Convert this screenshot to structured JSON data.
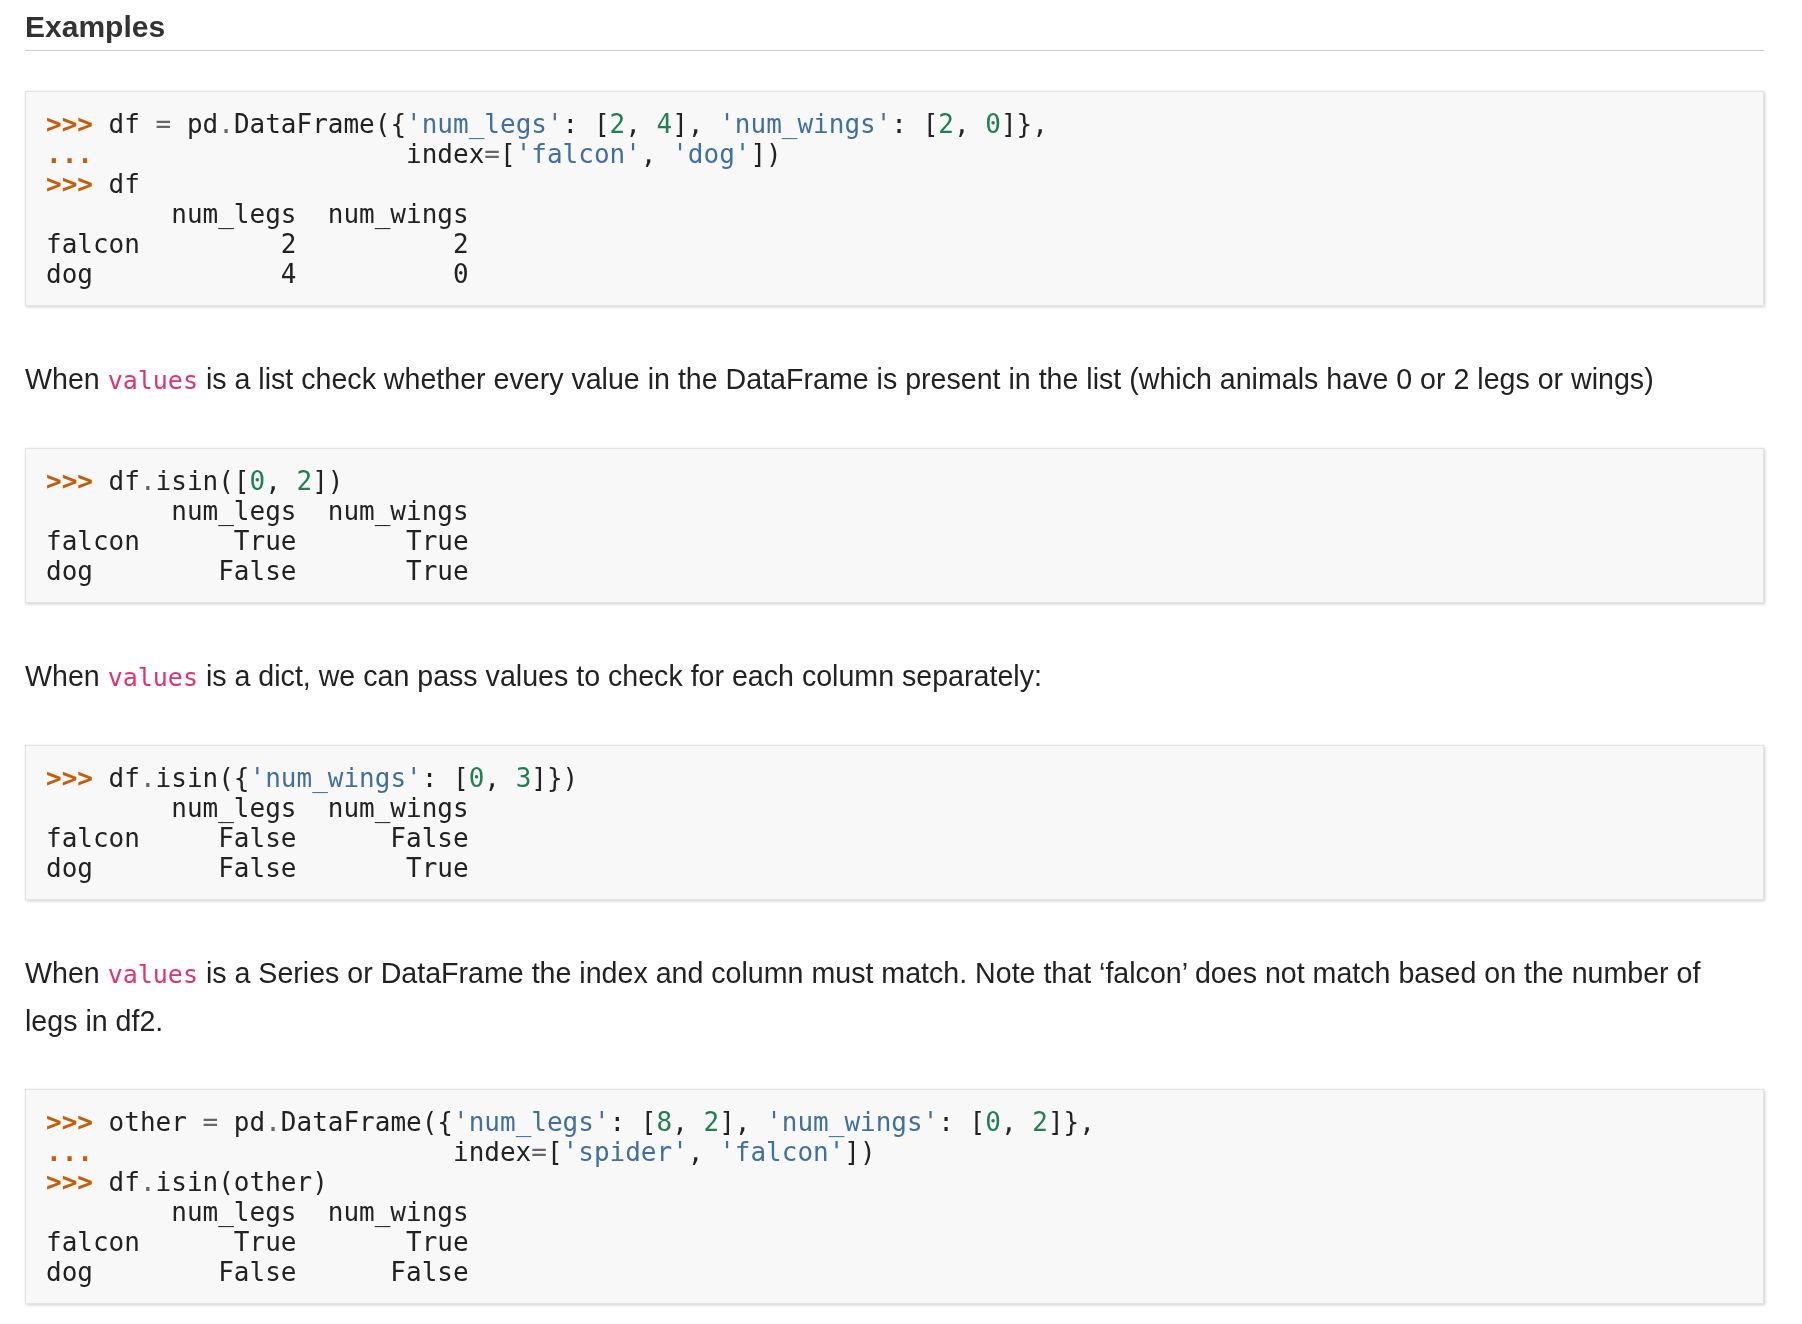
{
  "heading": "Examples",
  "blocks": [
    {
      "kind": "code",
      "lines": [
        [
          {
            "kind": "prompt",
            "text": ">>>"
          },
          {
            "kind": "plain",
            "text": " df "
          },
          {
            "kind": "op",
            "text": "="
          },
          {
            "kind": "plain",
            "text": " pd"
          },
          {
            "kind": "op",
            "text": "."
          },
          {
            "kind": "plain",
            "text": "DataFrame({"
          },
          {
            "kind": "string",
            "text": "'num_legs'"
          },
          {
            "kind": "plain",
            "text": ": ["
          },
          {
            "kind": "number",
            "text": "2"
          },
          {
            "kind": "plain",
            "text": ", "
          },
          {
            "kind": "number",
            "text": "4"
          },
          {
            "kind": "plain",
            "text": "], "
          },
          {
            "kind": "string",
            "text": "'num_wings'"
          },
          {
            "kind": "plain",
            "text": ": ["
          },
          {
            "kind": "number",
            "text": "2"
          },
          {
            "kind": "plain",
            "text": ", "
          },
          {
            "kind": "number",
            "text": "0"
          },
          {
            "kind": "plain",
            "text": "]},"
          }
        ],
        [
          {
            "kind": "prompt",
            "text": "..."
          },
          {
            "kind": "plain",
            "text": "                    index"
          },
          {
            "kind": "op",
            "text": "="
          },
          {
            "kind": "plain",
            "text": "["
          },
          {
            "kind": "string",
            "text": "'falcon'"
          },
          {
            "kind": "plain",
            "text": ", "
          },
          {
            "kind": "string",
            "text": "'dog'"
          },
          {
            "kind": "plain",
            "text": "])"
          }
        ],
        [
          {
            "kind": "prompt",
            "text": ">>>"
          },
          {
            "kind": "plain",
            "text": " df"
          }
        ],
        [
          {
            "kind": "plain",
            "text": "        num_legs  num_wings"
          }
        ],
        [
          {
            "kind": "plain",
            "text": "falcon         2          2"
          }
        ],
        [
          {
            "kind": "plain",
            "text": "dog            4          0"
          }
        ]
      ]
    },
    {
      "kind": "paragraph",
      "parts": [
        {
          "kind": "text",
          "text": "When "
        },
        {
          "kind": "code",
          "text": "values"
        },
        {
          "kind": "text",
          "text": " is a list check whether every value in the DataFrame is present in the list (which animals have 0 or 2 legs or wings)"
        }
      ]
    },
    {
      "kind": "code",
      "lines": [
        [
          {
            "kind": "prompt",
            "text": ">>>"
          },
          {
            "kind": "plain",
            "text": " df"
          },
          {
            "kind": "op",
            "text": "."
          },
          {
            "kind": "plain",
            "text": "isin(["
          },
          {
            "kind": "number",
            "text": "0"
          },
          {
            "kind": "plain",
            "text": ", "
          },
          {
            "kind": "number",
            "text": "2"
          },
          {
            "kind": "plain",
            "text": "])"
          }
        ],
        [
          {
            "kind": "plain",
            "text": "        num_legs  num_wings"
          }
        ],
        [
          {
            "kind": "plain",
            "text": "falcon      True       True"
          }
        ],
        [
          {
            "kind": "plain",
            "text": "dog        False       True"
          }
        ]
      ]
    },
    {
      "kind": "paragraph",
      "parts": [
        {
          "kind": "text",
          "text": "When "
        },
        {
          "kind": "code",
          "text": "values"
        },
        {
          "kind": "text",
          "text": " is a dict, we can pass values to check for each column separately:"
        }
      ]
    },
    {
      "kind": "code",
      "lines": [
        [
          {
            "kind": "prompt",
            "text": ">>>"
          },
          {
            "kind": "plain",
            "text": " df"
          },
          {
            "kind": "op",
            "text": "."
          },
          {
            "kind": "plain",
            "text": "isin({"
          },
          {
            "kind": "string",
            "text": "'num_wings'"
          },
          {
            "kind": "plain",
            "text": ": ["
          },
          {
            "kind": "number",
            "text": "0"
          },
          {
            "kind": "plain",
            "text": ", "
          },
          {
            "kind": "number",
            "text": "3"
          },
          {
            "kind": "plain",
            "text": "]})"
          }
        ],
        [
          {
            "kind": "plain",
            "text": "        num_legs  num_wings"
          }
        ],
        [
          {
            "kind": "plain",
            "text": "falcon     False      False"
          }
        ],
        [
          {
            "kind": "plain",
            "text": "dog        False       True"
          }
        ]
      ]
    },
    {
      "kind": "paragraph",
      "parts": [
        {
          "kind": "text",
          "text": "When "
        },
        {
          "kind": "code",
          "text": "values"
        },
        {
          "kind": "text",
          "text": " is a Series or DataFrame the index and column must match. Note that ‘falcon’ does not match based on the number of legs in df2."
        }
      ]
    },
    {
      "kind": "code",
      "lines": [
        [
          {
            "kind": "prompt",
            "text": ">>>"
          },
          {
            "kind": "plain",
            "text": " other "
          },
          {
            "kind": "op",
            "text": "="
          },
          {
            "kind": "plain",
            "text": " pd"
          },
          {
            "kind": "op",
            "text": "."
          },
          {
            "kind": "plain",
            "text": "DataFrame({"
          },
          {
            "kind": "string",
            "text": "'num_legs'"
          },
          {
            "kind": "plain",
            "text": ": ["
          },
          {
            "kind": "number",
            "text": "8"
          },
          {
            "kind": "plain",
            "text": ", "
          },
          {
            "kind": "number",
            "text": "2"
          },
          {
            "kind": "plain",
            "text": "], "
          },
          {
            "kind": "string",
            "text": "'num_wings'"
          },
          {
            "kind": "plain",
            "text": ": ["
          },
          {
            "kind": "number",
            "text": "0"
          },
          {
            "kind": "plain",
            "text": ", "
          },
          {
            "kind": "number",
            "text": "2"
          },
          {
            "kind": "plain",
            "text": "]},"
          }
        ],
        [
          {
            "kind": "prompt",
            "text": "..."
          },
          {
            "kind": "plain",
            "text": "                       index"
          },
          {
            "kind": "op",
            "text": "="
          },
          {
            "kind": "plain",
            "text": "["
          },
          {
            "kind": "string",
            "text": "'spider'"
          },
          {
            "kind": "plain",
            "text": ", "
          },
          {
            "kind": "string",
            "text": "'falcon'"
          },
          {
            "kind": "plain",
            "text": "])"
          }
        ],
        [
          {
            "kind": "prompt",
            "text": ">>>"
          },
          {
            "kind": "plain",
            "text": " df"
          },
          {
            "kind": "op",
            "text": "."
          },
          {
            "kind": "plain",
            "text": "isin(other)"
          }
        ],
        [
          {
            "kind": "plain",
            "text": "        num_legs  num_wings"
          }
        ],
        [
          {
            "kind": "plain",
            "text": "falcon      True       True"
          }
        ],
        [
          {
            "kind": "plain",
            "text": "dog        False      False"
          }
        ]
      ]
    }
  ]
}
